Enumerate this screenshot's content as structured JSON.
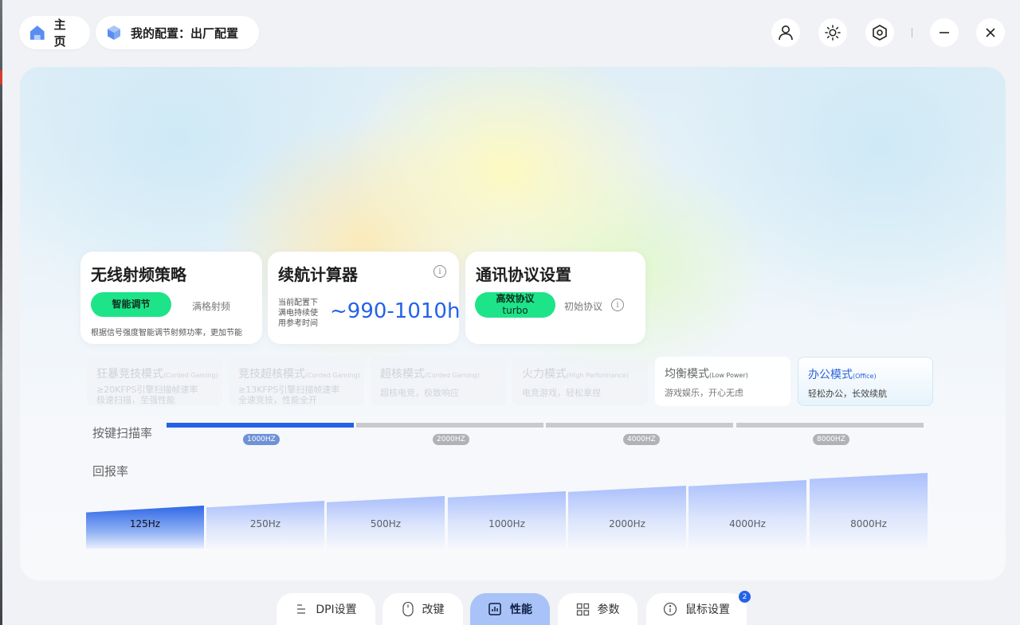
{
  "header": {
    "home_label": "主页",
    "config_label": "我的配置：出厂配置"
  },
  "cards": {
    "rf": {
      "title": "无线射频策略",
      "smart_label": "智能调节",
      "full_label": "满格射频",
      "desc": "根据信号强度智能调节射频功率，更加节能"
    },
    "battery": {
      "title": "续航计算器",
      "caption_lines": [
        "当前配置下",
        "满电持续使",
        "用参考时间"
      ],
      "value": "~990-1010h"
    },
    "protocol": {
      "title": "通讯协议设置",
      "active_label_1": "高效协议",
      "active_label_2": "turbo",
      "initial_label": "初始协议"
    }
  },
  "modes": [
    {
      "name": "狂暴竞技模式",
      "en": "(Corded Gaming)",
      "desc1": "≥20KFPS引擎扫描帧速率",
      "desc2": "极速扫描，至强性能",
      "state": "faded"
    },
    {
      "name": "竞技超核模式",
      "en": "(Corded Gaming)",
      "desc1": "≥13KFPS引擎扫描帧速率",
      "desc2": "全速竞技，性能全开",
      "state": "faded"
    },
    {
      "name": "超核模式",
      "en": "(Corded Gaming)",
      "desc1": "超核电竞，极致响应",
      "desc2": "",
      "state": "faded"
    },
    {
      "name": "火力模式",
      "en": "(High Performance)",
      "desc1": "电竞游戏，轻松拿捏",
      "desc2": "",
      "state": "faded"
    },
    {
      "name": "均衡模式",
      "en": "(Low Power)",
      "desc1": "游戏娱乐，开心无虑",
      "desc2": "",
      "state": "normal"
    },
    {
      "name": "办公模式",
      "en": "(Office)",
      "desc1": "轻松办公，长效续航",
      "desc2": "",
      "state": "selected"
    }
  ],
  "scan_rate": {
    "label": "按键扫描率",
    "selected": "1000HZ",
    "options": [
      "1000HZ",
      "2000HZ",
      "4000HZ",
      "8000HZ"
    ]
  },
  "report_rate": {
    "label": "回报率",
    "selected": "125Hz",
    "options": [
      "125Hz",
      "250Hz",
      "500Hz",
      "1000Hz",
      "2000Hz",
      "4000Hz",
      "8000Hz"
    ]
  },
  "tabs": {
    "dpi": "DPI设置",
    "remap": "改键",
    "perf": "性能",
    "params": "参数",
    "mouse": "鼠标设置",
    "mouse_badge": "2",
    "active": "性能"
  },
  "colors": {
    "accent": "#2462e8",
    "green": "#1ee489",
    "tab_active": "#a9c3f9"
  }
}
